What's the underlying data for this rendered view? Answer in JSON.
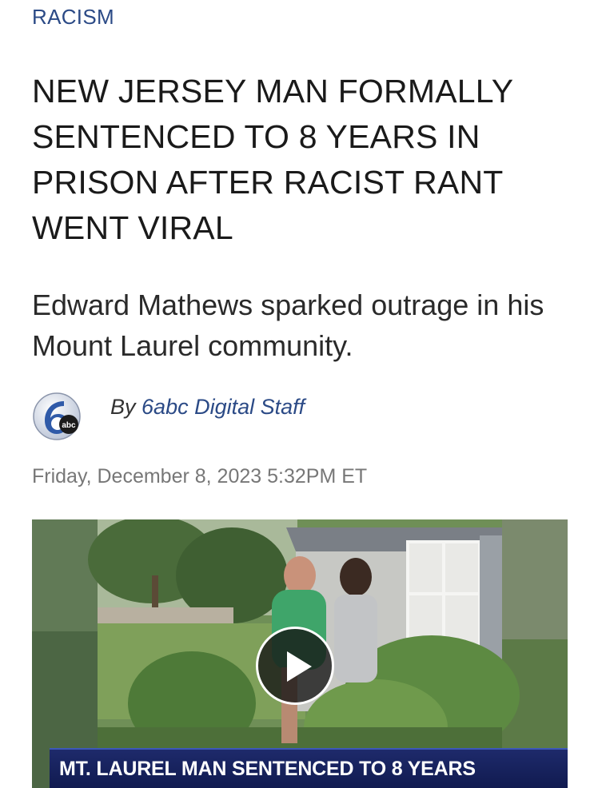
{
  "article": {
    "category": "RACISM",
    "headline": "NEW JERSEY MAN FORMALLY SENTENCED TO 8 YEARS IN PRISON AFTER RACIST RANT WENT VIRAL",
    "subheadline": "Edward Mathews sparked outrage in his Mount Laurel community.",
    "byline_prefix": "By",
    "byline_author": "6abc Digital Staff",
    "date": "Friday, December 8, 2023 5:32PM ET"
  },
  "logo": {
    "icon": "6abc-logo-icon",
    "text": "abc"
  },
  "video": {
    "lower_third": "MT. LAUREL MAN SENTENCED TO 8 YEARS",
    "play_icon": "play-icon"
  },
  "colors": {
    "accent": "#2b4a86",
    "headline": "#1a1a1a",
    "date": "#777777",
    "banner": "#101a4f"
  }
}
